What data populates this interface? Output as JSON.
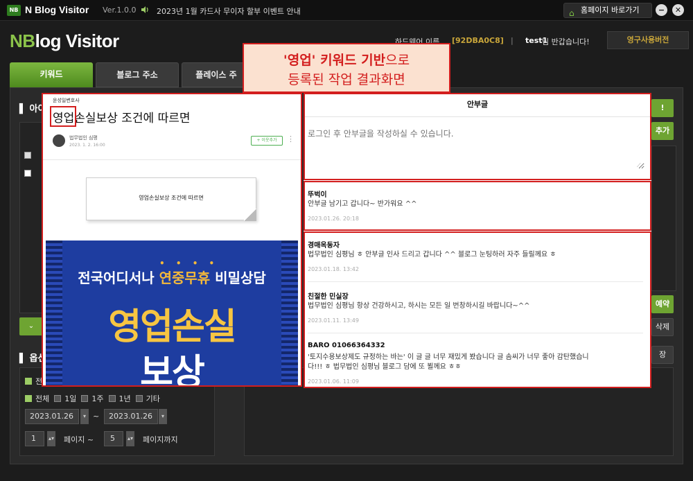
{
  "titlebar": {
    "logo": "NB",
    "app_name": "N Blog Visitor",
    "version": "Ver.1.0.0",
    "notice": "2023년 1월 카드사 무이자 할부 이벤트 안내",
    "home_button": "홈페이지 바로가기",
    "minimize": "−",
    "close": "✕"
  },
  "header": {
    "brand_n": "NB",
    "brand_rest": "log Visitor",
    "hardware_label": "하드웨어 이름",
    "hardware_id": "[92DBA0C8]",
    "separator": "|",
    "user_name": "test1",
    "user_greeting": "님 반갑습니다!",
    "license": "영구사용버전"
  },
  "tabs": [
    {
      "label": "키워드",
      "active": true
    },
    {
      "label": "블로그 주소",
      "active": false
    },
    {
      "label": "플레이스 주",
      "active": false
    }
  ],
  "left": {
    "section_title": "아이",
    "options_title": "옵션",
    "down_button": "⌄"
  },
  "right_buttons": {
    "run": "!",
    "add": "추가",
    "reserve": "예약",
    "delete": "삭제",
    "save": "장"
  },
  "options": {
    "row1_first": "전",
    "period_options": [
      "전체",
      "1일",
      "1주",
      "1년",
      "기타"
    ],
    "date_from": "2023.01.26",
    "date_sep": "~",
    "date_to": "2023.01.26",
    "page_from": "1",
    "page_from_label": "페이지 ~",
    "page_to": "5",
    "page_to_label": "페이지까지"
  },
  "callout": {
    "line1_bold": "'영업' 키워드 기반",
    "line1_rest": "으로",
    "line2": "등록된 작업 결과화면"
  },
  "post": {
    "category": "윤성일변호사",
    "title_highlight": "영업",
    "title_rest": "손실보상 조건에 따르면",
    "author": "법무법인 심평",
    "date": "2023. 1. 2. 16:00",
    "follow": "+ 이웃추가",
    "more": "⋮",
    "card_text": "영업손실보상 조건에 따르면",
    "banner_dots": "• • • •",
    "banner_sub_white1": "전국어디서나 ",
    "banner_sub_yellow": "연중무휴",
    "banner_sub_white2": " 비밀상담",
    "banner_big1": "영업손실",
    "banner_big2": "보상"
  },
  "guestbook": {
    "title": "안부글",
    "placeholder": "로그인 후 안부글을 작성하실 수 있습니다.",
    "entries": [
      {
        "author": "뚜벅이",
        "text": "안부글 남기고 갑니다~ 반가워요 ^^",
        "date": "2023.01.26. 20:18"
      },
      {
        "author": "경매옥동자",
        "text": "법무법인 심평님 ㅎ 안부글 인사 드리고 갑니다 ^^ 블로그 눈팅하러 자주 들릴께요 ㅎ",
        "date": "2023.01.18. 13:42"
      },
      {
        "author": "친절한 민실장",
        "text": "법무법인 심평님 항상 건강하시고, 하시는 모든 일 번창하시길 바랍니다~^^",
        "date": "2023.01.11. 13:49"
      },
      {
        "author": "BARO 01066364332",
        "text_line1": "'토지수용보상제도 규정하는 바는' 이 글 글 너무 재밌게 봤습니다 글 솜씨가 너무 좋아 감탄했습니",
        "text_line2": "다!!! ㅎ 법무법인 심평님 블로그 담에 또 뵐께요 ㅎㅎ",
        "date": "2023.01.06. 11:09"
      }
    ]
  },
  "colors": {
    "accent": "#7cb73f",
    "highlight": "#d31e1e",
    "gold": "#c9a63a"
  }
}
